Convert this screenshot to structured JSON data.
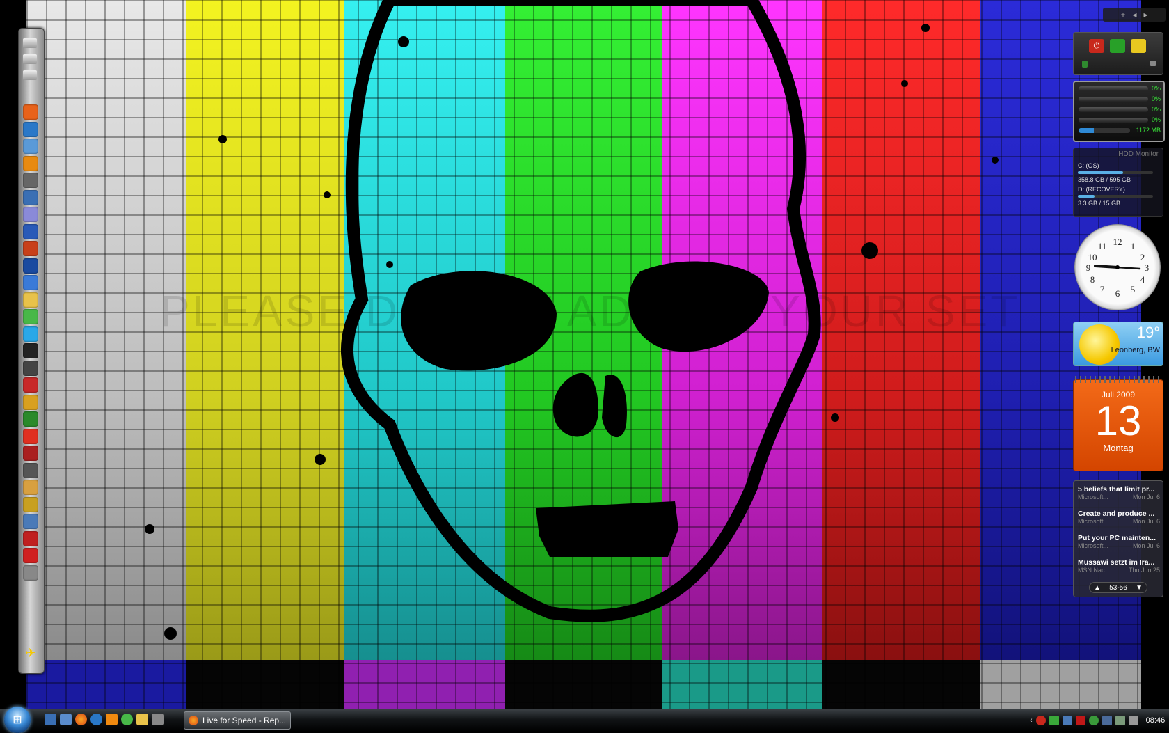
{
  "wallpaper": {
    "text": "PLEASE DO NOT ADJUST YOUR SET"
  },
  "dock": {
    "icons": [
      "firefox-icon",
      "ie-icon",
      "itunes-icon",
      "media-player-icon",
      "music-icon",
      "vlc-icon",
      "audio-icon",
      "save-icon",
      "game-icon",
      "media-center-icon",
      "messenger-icon",
      "mail-icon",
      "clover-icon",
      "skype-icon",
      "nvidia-icon",
      "counter-strike-icon",
      "left4dead-icon",
      "half-life-icon",
      "tool-icon",
      "target-icon",
      "fear-icon",
      "game2-icon",
      "eagle-icon",
      "unreal-icon",
      "racing-icon",
      "speed-icon",
      "arrow-icon",
      "generic-icon"
    ]
  },
  "sidebar": {
    "cpu": {
      "rows": [
        "0%",
        "0%",
        "0%",
        "0%"
      ],
      "memory": "1172 MB"
    },
    "hdd": {
      "title": "HDD Monitor",
      "drives": [
        {
          "label": "C: (OS)",
          "usage": "358.8 GB / 595 GB",
          "fill": 0.6
        },
        {
          "label": "D: (RECOVERY)",
          "usage": "3.3 GB / 15 GB",
          "fill": 0.22
        }
      ]
    },
    "weather": {
      "temp": "19°",
      "location": "Leonberg, BW"
    },
    "calendar": {
      "month": "Juli 2009",
      "day": "13",
      "weekday": "Montag"
    },
    "feed": {
      "items": [
        {
          "title": "5 beliefs that limit pr...",
          "source": "Microsoft...",
          "date": "Mon Jul 6"
        },
        {
          "title": "Create and produce ...",
          "source": "Microsoft...",
          "date": "Mon Jul 6"
        },
        {
          "title": "Put your PC mainten...",
          "source": "Microsoft...",
          "date": "Mon Jul 6"
        },
        {
          "title": "Mussawi setzt im Ira...",
          "source": "MSN Nac...",
          "date": "Thu Jun 25"
        }
      ],
      "range": "53-56"
    }
  },
  "taskbar": {
    "task_label": "Live for Speed - Rep...",
    "clock": "08:46"
  },
  "colors": {
    "accent": "#3a8ad6",
    "calendar": "#e2560a"
  }
}
